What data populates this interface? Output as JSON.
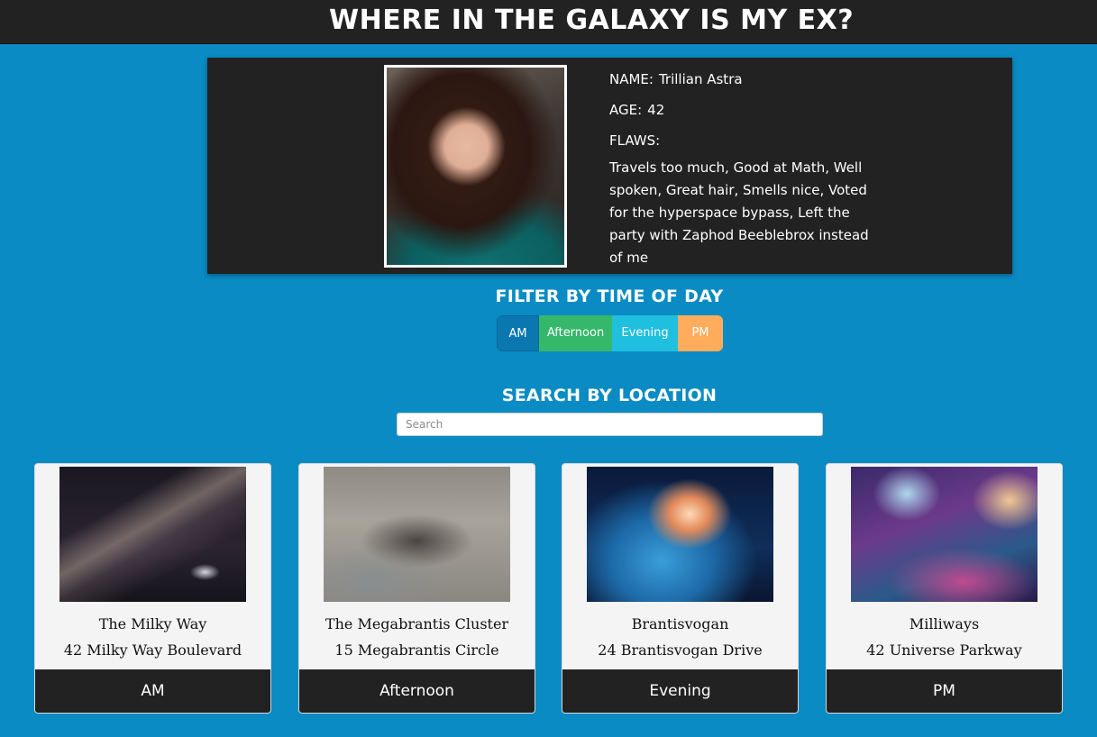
{
  "header": {
    "title": "Where in the Galaxy is my Ex?"
  },
  "profile": {
    "name_label": "NAME:",
    "name": "Trillian Astra",
    "age_label": "AGE:",
    "age": "42",
    "flaws_label": "FLAWS:",
    "flaws": "Travels too much, Good at Math, Well spoken, Great hair, Smells nice, Voted for the hyperspace bypass, Left the party with Zaphod Beeblebrox instead of me"
  },
  "filter": {
    "title": "Filter by time of day",
    "buttons": [
      {
        "label": "AM",
        "color": "#0b77b0"
      },
      {
        "label": "Afternoon",
        "color": "#35b86a"
      },
      {
        "label": "Evening",
        "color": "#1fbfe0"
      },
      {
        "label": "PM",
        "color": "#ffad5c"
      }
    ]
  },
  "search": {
    "title": "Search by location",
    "placeholder": "Search",
    "value": ""
  },
  "locations": [
    {
      "name": "The Milky Way",
      "address": "42 Milky Way Boulevard",
      "time": "AM"
    },
    {
      "name": "The Megabrantis Cluster",
      "address": "15 Megabrantis Circle",
      "time": "Afternoon"
    },
    {
      "name": "Brantisvogan",
      "address": "24 Brantisvogan Drive",
      "time": "Evening"
    },
    {
      "name": "Milliways",
      "address": "42 Universe Parkway",
      "time": "PM"
    }
  ],
  "theme": {
    "background": "#0a8bc4",
    "panel": "#222222",
    "card": "#f4f4f4"
  }
}
